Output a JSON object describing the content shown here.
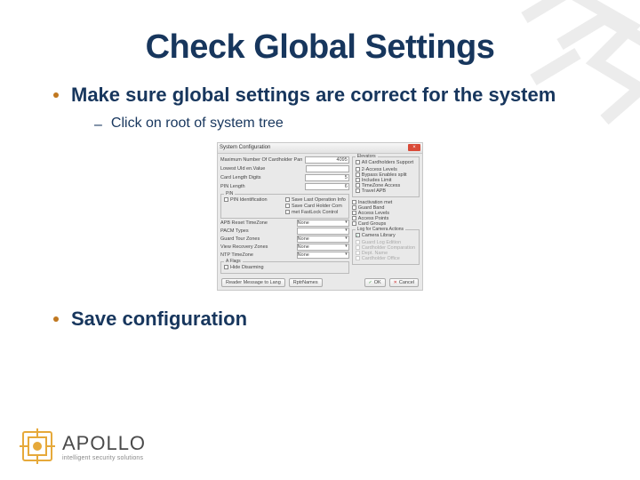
{
  "title": "Check Global Settings",
  "bullets": [
    {
      "text": "Make sure global settings are correct for the system",
      "sub": [
        {
          "text": "Click on root of system tree"
        }
      ]
    },
    {
      "text": "Save configuration",
      "orange": true
    }
  ],
  "dialog": {
    "title": "System Configuration",
    "rows": {
      "max_cards": "Maximum Number Of Cardholder Panel",
      "lowest_uid": "Lowest UId en.Value",
      "card_len": "Card Length Digits",
      "pin_len": "PIN Length",
      "val_max": "4095",
      "val_5": "5",
      "val_6": "6"
    },
    "pin_group": {
      "legend": "PIN",
      "left": [
        "PIN Identification"
      ],
      "right": [
        "Save Last Operation Info",
        "Save Card Holder Com",
        "met FastLock Control"
      ]
    },
    "dropdowns": {
      "apb": {
        "label": "APB Reset TimeZone",
        "value": "None"
      },
      "pacm": {
        "label": "PACM Types",
        "value": ""
      },
      "guard": {
        "label": "Guard Tour Zones",
        "value": "None"
      },
      "vrecv": {
        "label": "View Recovery Zones",
        "value": "None"
      },
      "ntp": {
        "label": "NTP TimeZone",
        "value": "None"
      }
    },
    "alog": {
      "legend": "A Flags",
      "option": "Hide Disarming"
    },
    "elevators": {
      "legend": "Elevators",
      "items": [
        "All Cardholders Support",
        "2-Access Levels",
        "Bypass Enables split",
        "Includes Limit",
        "TimeZone Access",
        "Travel APB"
      ]
    },
    "mon_items": [
      "Inactivation met",
      "Guard Band",
      "Access Levels",
      "Access Points",
      "Card Groups"
    ],
    "log_config": {
      "legend": "Log for Camera Actions",
      "top": "Camera Library",
      "items": [
        "Guard Log Edition",
        "Cardholder Comparation",
        "Dept. Name",
        "Cardholder Office"
      ]
    },
    "footer": {
      "reader_msg": "Reader Message to Lang",
      "rptr": "RptrNames",
      "ok": "OK",
      "cancel": "Cancel"
    }
  },
  "logo": {
    "name": "APOLLO",
    "tagline": "intelligent security solutions"
  }
}
